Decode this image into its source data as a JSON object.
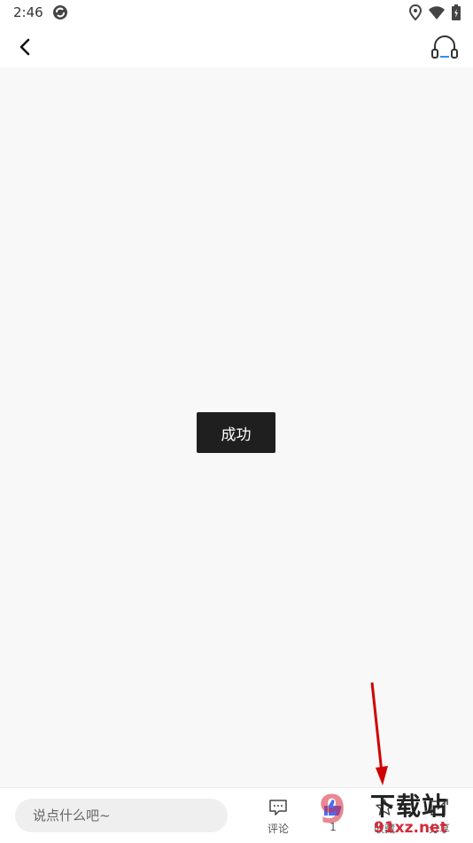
{
  "status_bar": {
    "time": "2:46"
  },
  "toast": {
    "text": "成功"
  },
  "bottom_bar": {
    "input_placeholder": "说点什么吧~",
    "comment_label": "评论",
    "like_count": "1",
    "favorite_label": "收藏",
    "share_label": "分享"
  },
  "watermark": {
    "logo": "9",
    "title": "下载站",
    "url": "91xz.net"
  },
  "colors": {
    "toast_bg": "#1f1f1f",
    "like_blue": "#4a6cf7",
    "annotation_arrow": "#d10000",
    "watermark_red": "#d32b3a"
  }
}
